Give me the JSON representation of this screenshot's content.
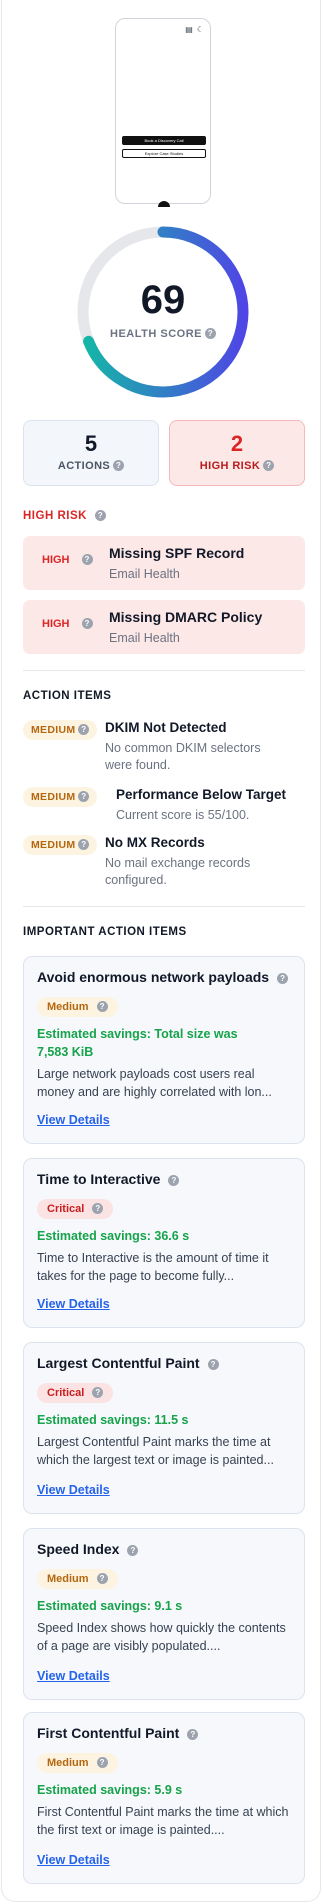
{
  "phone_preview": {
    "primary_button": "Book a Discovery Call",
    "secondary_button": "Explore Case Studies"
  },
  "health": {
    "score": "69",
    "label": "HEALTH SCORE",
    "score_value": 69,
    "gradient_start": "#14b8a6",
    "gradient_end": "#4f46e5",
    "track_color": "#e5e7eb"
  },
  "stats": {
    "actions": {
      "count": "5",
      "label": "ACTIONS"
    },
    "high_risk": {
      "count": "2",
      "label": "HIGH RISK"
    }
  },
  "high_risk": {
    "title": "HIGH RISK",
    "items": [
      {
        "tag": "HIGH",
        "title": "Missing SPF Record",
        "category": "Email Health"
      },
      {
        "tag": "HIGH",
        "title": "Missing DMARC Policy",
        "category": "Email Health"
      }
    ]
  },
  "action_items": {
    "title": "ACTION ITEMS",
    "items": [
      {
        "priority": "MEDIUM",
        "title": "DKIM Not Detected",
        "desc_1": "No common DKIM selectors",
        "desc_2": "were found."
      },
      {
        "priority": "MEDIUM",
        "title": "Performance Below Target",
        "desc_1": "Current score is 55/100.",
        "desc_2": ""
      },
      {
        "priority": "MEDIUM",
        "title": "No MX Records",
        "desc_1": "No mail exchange records",
        "desc_2": "configured."
      }
    ]
  },
  "important": {
    "title": "IMPORTANT ACTION ITEMS",
    "link_label": "View Details",
    "items": [
      {
        "title": "Avoid enormous network payloads",
        "severity": "Medium",
        "savings_1": "Estimated savings: Total size was",
        "savings_2": "7,583 KiB",
        "desc": "Large network payloads cost users real money and are highly correlated with lon..."
      },
      {
        "title": "Time to Interactive",
        "severity": "Critical",
        "savings_1": "Estimated savings: 36.6 s",
        "desc": "Time to Interactive is the amount of time it takes for the page to become fully..."
      },
      {
        "title": "Largest Contentful Paint",
        "severity": "Critical",
        "savings_1": "Estimated savings: 11.5 s",
        "desc": "Largest Contentful Paint marks the time at which the largest text or image is painted..."
      },
      {
        "title": "Speed Index",
        "severity": "Medium",
        "savings_1": "Estimated savings: 9.1 s",
        "desc": "Speed Index shows how quickly the contents of a page are visibly populated...."
      },
      {
        "title": "First Contentful Paint",
        "severity": "Medium",
        "savings_1": "Estimated savings: 5.9 s",
        "desc": "First Contentful Paint marks the time at which the first text or image is painted...."
      }
    ]
  }
}
